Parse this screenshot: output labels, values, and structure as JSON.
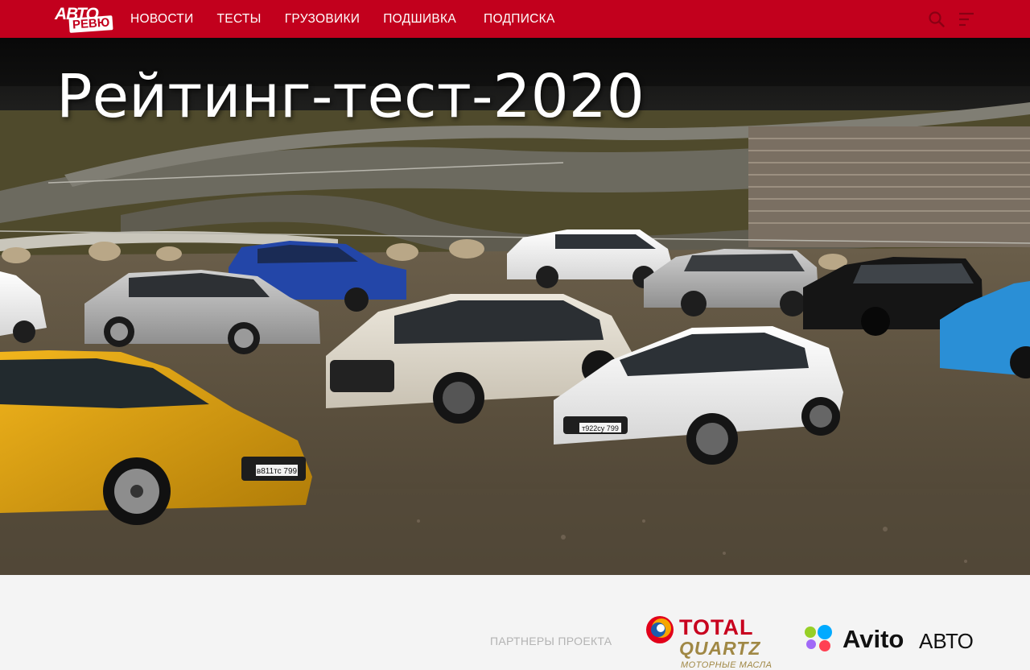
{
  "header": {
    "logo_top": "АВТО",
    "logo_bottom": "РЕВЮ",
    "nav": [
      "НОВОСТИ",
      "ТЕСТЫ",
      "ГРУЗОВИКИ",
      "ПОДШИВКА",
      "ПОДПИСКА"
    ],
    "icons": [
      "search-icon",
      "menu-icon"
    ],
    "accent_color": "#c2001d"
  },
  "hero": {
    "title": "Рейтинг-тест-2020",
    "plate_1": "в811тс 799",
    "plate_2": "т922су 799"
  },
  "partners": {
    "label": "ПАРТНЕРЫ ПРОЕКТА",
    "total": {
      "word": "TOTAL",
      "quartz": "QUARTZ",
      "subtitle": "МОТОРНЫЕ МАСЛА"
    },
    "avito": {
      "word": "Avito",
      "suffix": "АВТО"
    }
  }
}
